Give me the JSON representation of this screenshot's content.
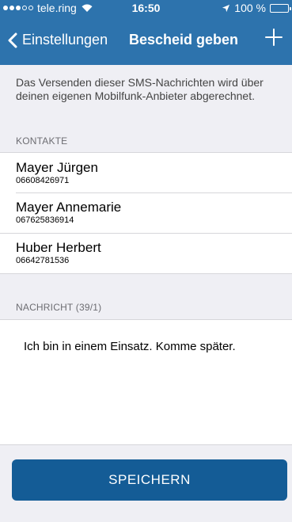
{
  "statusbar": {
    "carrier": "tele.ring",
    "time": "16:50",
    "battery": "100 %"
  },
  "navbar": {
    "back_label": "Einstellungen",
    "title": "Bescheid geben"
  },
  "info_text": "Das Versenden dieser SMS-Nachrichten wird über deinen eigenen Mobilfunk-Anbieter abgerechnet.",
  "contacts": {
    "header": "KONTAKTE",
    "items": [
      {
        "name": "Mayer Jürgen",
        "phone": "06608426971"
      },
      {
        "name": "Mayer Annemarie",
        "phone": "067625836914"
      },
      {
        "name": "Huber Herbert",
        "phone": "06642781536"
      }
    ]
  },
  "message": {
    "header": "NACHRICHT (39/1)",
    "text": "Ich bin in einem Einsatz. Komme später."
  },
  "save_label": "SPEICHERN",
  "colors": {
    "header": "#2d73ad",
    "button": "#145c96",
    "background": "#efeff4"
  },
  "icons": [
    "signal-icon",
    "wifi-icon",
    "location-arrow-icon",
    "battery-icon",
    "back-chevron-icon",
    "plus-icon"
  ]
}
